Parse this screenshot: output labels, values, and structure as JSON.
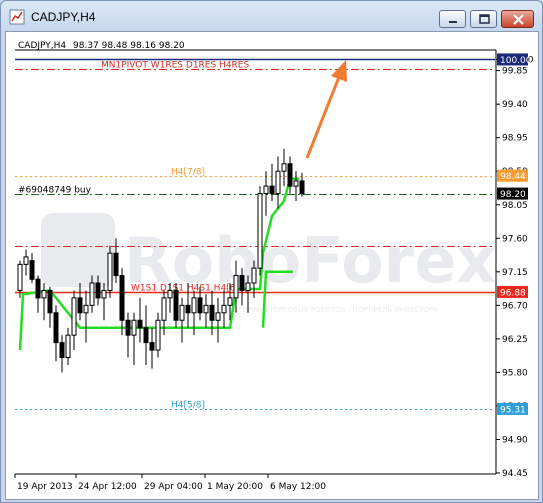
{
  "window": {
    "title": "CADJPY,H4"
  },
  "chart_header": {
    "symbol": "CADJPY,H4",
    "ohlc": "98.37 98.48 98.16 98.20"
  },
  "watermark": {
    "brand": "RoboForex",
    "tagline": "МОНИТОРИНГ ТОРГОВЫХ РОБОТОВ - ПОРТФЕЛЬ ИНВЕСТОРА"
  },
  "chart_data": {
    "type": "candlestick",
    "ylim": [
      94.45,
      100.1
    ],
    "y_ticks": [
      "100.00",
      "99.85",
      "99.40",
      "98.95",
      "98.50",
      "98.05",
      "97.60",
      "97.15",
      "96.70",
      "96.25",
      "95.80",
      "95.35",
      "94.90",
      "94.45"
    ],
    "x_ticks": [
      "19 Apr 2013",
      "24 Apr 12:00",
      "29 Apr 04:00",
      "1 May 20:00",
      "6 May 12:00"
    ],
    "price_badges": [
      {
        "value": "100.00",
        "color": "#1a2a7a"
      },
      {
        "value": "98.44",
        "color": "#ff9a2e"
      },
      {
        "value": "98.20",
        "color": "#000000"
      },
      {
        "value": "96.88",
        "color": "#e8281c"
      },
      {
        "value": "95.31",
        "color": "#2f9fd6"
      }
    ],
    "levels": [
      {
        "value": 100.0,
        "style": "solid",
        "color": "#1a2a7a"
      },
      {
        "value": 99.87,
        "style": "dashdot",
        "color": "#d03020",
        "label": "MN1PIVOT W1RES D1RES H4RES"
      },
      {
        "value": 98.44,
        "style": "dotted",
        "color": "#ff9a2e",
        "label": "H4[7/8]"
      },
      {
        "value": 98.2,
        "style": "dashdot",
        "color": "#1e6a1e",
        "label": "#69048749 buy"
      },
      {
        "value": 97.5,
        "style": "dashdot",
        "color": "#d03020"
      },
      {
        "value": 96.88,
        "style": "solid",
        "color": "#e8281c",
        "label": "W1S1 D1S1 H4S1 H4[6/8]"
      },
      {
        "value": 95.31,
        "style": "dotted",
        "color": "#2f9fd6",
        "label": "H4[5/8]"
      }
    ],
    "candles": [
      [
        96.9,
        97.3,
        96.8,
        97.25
      ],
      [
        97.25,
        97.45,
        97.1,
        97.35
      ],
      [
        97.3,
        97.4,
        97.0,
        97.05
      ],
      [
        97.05,
        97.1,
        96.6,
        96.8
      ],
      [
        96.8,
        97.0,
        96.5,
        96.9
      ],
      [
        96.9,
        96.95,
        96.4,
        96.6
      ],
      [
        96.6,
        96.7,
        95.95,
        96.2
      ],
      [
        96.2,
        96.3,
        95.8,
        96.0
      ],
      [
        96.0,
        96.4,
        95.9,
        96.3
      ],
      [
        96.3,
        96.9,
        96.1,
        96.8
      ],
      [
        96.8,
        97.0,
        96.5,
        96.6
      ],
      [
        96.6,
        96.9,
        96.2,
        96.7
      ],
      [
        96.7,
        97.1,
        96.6,
        97.0
      ],
      [
        97.0,
        97.1,
        96.7,
        96.8
      ],
      [
        96.8,
        97.0,
        96.5,
        96.9
      ],
      [
        96.9,
        97.5,
        96.8,
        97.4
      ],
      [
        97.4,
        97.6,
        97.0,
        97.1
      ],
      [
        97.1,
        97.2,
        96.3,
        96.5
      ],
      [
        96.5,
        96.6,
        96.0,
        96.3
      ],
      [
        96.3,
        96.6,
        95.9,
        96.5
      ],
      [
        96.5,
        96.8,
        96.2,
        96.4
      ],
      [
        96.4,
        96.7,
        95.9,
        96.2
      ],
      [
        96.2,
        96.4,
        95.85,
        96.1
      ],
      [
        96.1,
        96.6,
        96.0,
        96.5
      ],
      [
        96.5,
        96.9,
        96.3,
        96.8
      ],
      [
        96.8,
        97.0,
        96.6,
        96.9
      ],
      [
        96.9,
        97.0,
        96.4,
        96.5
      ],
      [
        96.5,
        96.8,
        96.2,
        96.7
      ],
      [
        96.7,
        97.0,
        96.4,
        96.6
      ],
      [
        96.6,
        96.9,
        96.3,
        96.8
      ],
      [
        96.8,
        96.95,
        96.5,
        96.6
      ],
      [
        96.6,
        96.85,
        96.4,
        96.7
      ],
      [
        96.7,
        96.9,
        96.3,
        96.5
      ],
      [
        96.5,
        96.8,
        96.2,
        96.6
      ],
      [
        96.6,
        96.9,
        96.4,
        96.7
      ],
      [
        96.7,
        97.0,
        96.5,
        96.8
      ],
      [
        96.8,
        97.3,
        96.6,
        97.1
      ],
      [
        97.1,
        97.2,
        96.7,
        96.9
      ],
      [
        96.9,
        97.1,
        96.6,
        97.0
      ],
      [
        97.0,
        97.3,
        96.8,
        97.2
      ],
      [
        97.2,
        98.3,
        97.1,
        98.2
      ],
      [
        98.2,
        98.5,
        97.9,
        98.3
      ],
      [
        98.3,
        98.6,
        98.1,
        98.2
      ],
      [
        98.2,
        98.7,
        98.0,
        98.5
      ],
      [
        98.5,
        98.8,
        98.3,
        98.6
      ],
      [
        98.6,
        98.7,
        98.2,
        98.3
      ],
      [
        98.3,
        98.5,
        98.1,
        98.37
      ],
      [
        98.37,
        98.48,
        98.16,
        98.2
      ]
    ],
    "indicator_line": {
      "color": "#22dd22",
      "points": [
        [
          0,
          96.1
        ],
        [
          0.5,
          96.85
        ],
        [
          5,
          96.9
        ],
        [
          10,
          96.4
        ],
        [
          35,
          96.4
        ],
        [
          36,
          96.92
        ],
        [
          40,
          96.92
        ],
        [
          40.5,
          97.4
        ],
        [
          42,
          97.9
        ],
        [
          44,
          98.1
        ],
        [
          45,
          98.4
        ],
        [
          46.5,
          98.4
        ]
      ]
    },
    "indicator_line2": {
      "color": "#22dd22",
      "points": [
        [
          40.5,
          96.4
        ],
        [
          41,
          97.15
        ],
        [
          45.5,
          97.15
        ]
      ]
    }
  }
}
